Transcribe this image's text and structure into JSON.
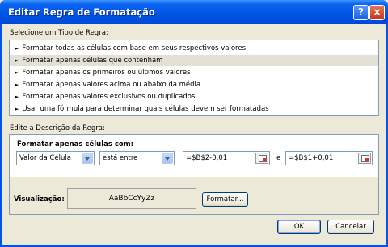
{
  "window": {
    "title": "Editar Regra de Formatação",
    "help_glyph": "?",
    "close_glyph": "×"
  },
  "rule_type": {
    "label": "Selecione um Tipo de Regra:",
    "bullet": "►",
    "items": [
      {
        "label": "Formatar todas as células com base em seus respectivos valores"
      },
      {
        "label": "Formatar apenas células que contenham",
        "selected": true
      },
      {
        "label": "Formatar apenas os primeiros ou últimos valores"
      },
      {
        "label": "Formatar apenas valores acima ou abaixo da média"
      },
      {
        "label": "Formatar apenas valores exclusivos ou duplicados"
      },
      {
        "label": "Usar uma fórmula para determinar quais células devem ser formatadas"
      }
    ]
  },
  "description": {
    "label": "Edite a Descrição da Regra:",
    "heading": "Formatar apenas células com:",
    "condition_type": "Valor da Célula",
    "operator": "está entre",
    "value1": "=$B$2-0,01",
    "connector": "e",
    "value2": "=$B$1+0,01",
    "preview_label": "Visualização:",
    "preview_sample": "AaBbCcYyZz",
    "format_button": "Formatar..."
  },
  "footer": {
    "ok": "OK",
    "cancel": "Cancelar"
  }
}
